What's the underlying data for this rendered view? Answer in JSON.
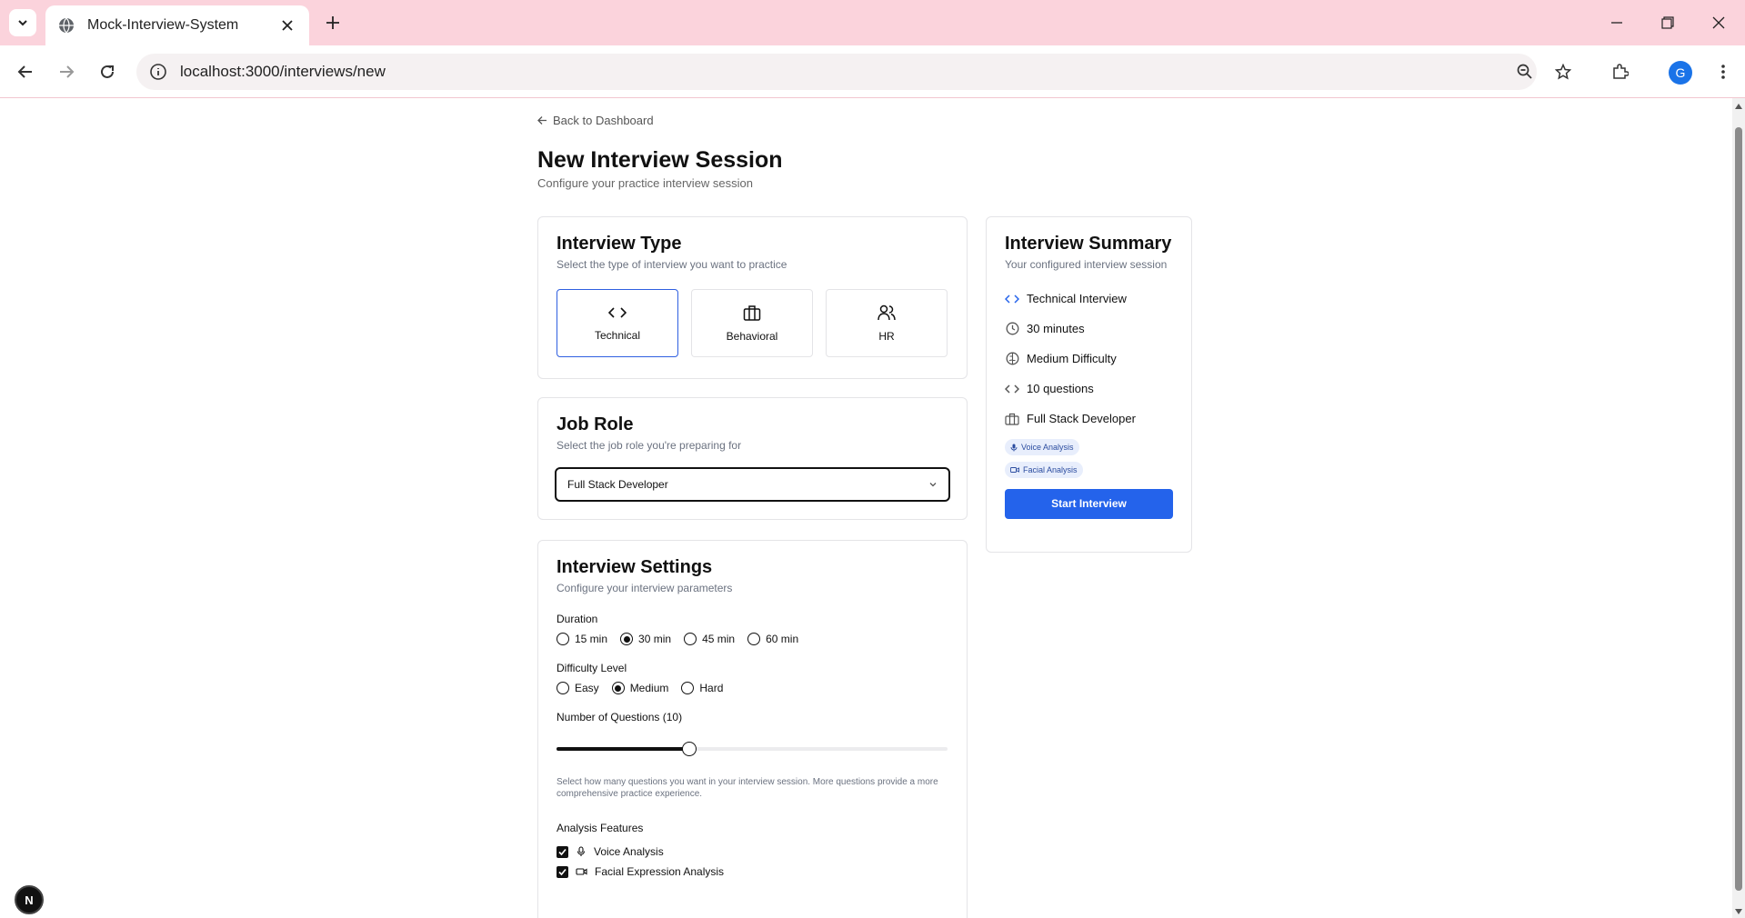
{
  "browser": {
    "tab_title": "Mock-Interview-System",
    "url": "localhost:3000/interviews/new",
    "profile_initial": "G"
  },
  "page": {
    "back_link": "Back to Dashboard",
    "title": "New Interview Session",
    "subtitle": "Configure your practice interview session"
  },
  "interview_type": {
    "title": "Interview Type",
    "subtitle": "Select the type of interview you want to practice",
    "options": [
      {
        "label": "Technical",
        "icon": "code-icon",
        "selected": true
      },
      {
        "label": "Behavioral",
        "icon": "briefcase-icon",
        "selected": false
      },
      {
        "label": "HR",
        "icon": "users-icon",
        "selected": false
      }
    ]
  },
  "job_role": {
    "title": "Job Role",
    "subtitle": "Select the job role you're preparing for",
    "selected": "Full Stack Developer"
  },
  "settings": {
    "title": "Interview Settings",
    "subtitle": "Configure your interview parameters",
    "duration_label": "Duration",
    "durations": [
      "15 min",
      "30 min",
      "45 min",
      "60 min"
    ],
    "duration_selected": 1,
    "difficulty_label": "Difficulty Level",
    "difficulties": [
      "Easy",
      "Medium",
      "Hard"
    ],
    "difficulty_selected": 1,
    "questions_label": "Number of Questions (10)",
    "questions_slider_fraction": 0.34,
    "questions_help": "Select how many questions you want in your interview session. More questions provide a more comprehensive practice experience.",
    "analysis_label": "Analysis Features",
    "analysis": [
      {
        "label": "Voice Analysis",
        "icon": "mic-icon",
        "checked": true
      },
      {
        "label": "Facial Expression Analysis",
        "icon": "video-icon",
        "checked": true
      }
    ]
  },
  "summary": {
    "title": "Interview Summary",
    "subtitle": "Your configured interview session",
    "items": [
      {
        "text": "Technical Interview",
        "icon": "code-icon"
      },
      {
        "text": "30 minutes",
        "icon": "clock-icon"
      },
      {
        "text": "Medium Difficulty",
        "icon": "brain-icon"
      },
      {
        "text": "10 questions",
        "icon": "code-icon"
      },
      {
        "text": "Full Stack Developer",
        "icon": "briefcase-icon"
      }
    ],
    "badges": [
      "Voice Analysis",
      "Facial Analysis"
    ],
    "start_button": "Start Interview"
  },
  "dev_badge": "N",
  "colors": {
    "accent": "#2463eb",
    "chrome": "#fbd3dc",
    "badge_bg": "#e8eefc"
  }
}
